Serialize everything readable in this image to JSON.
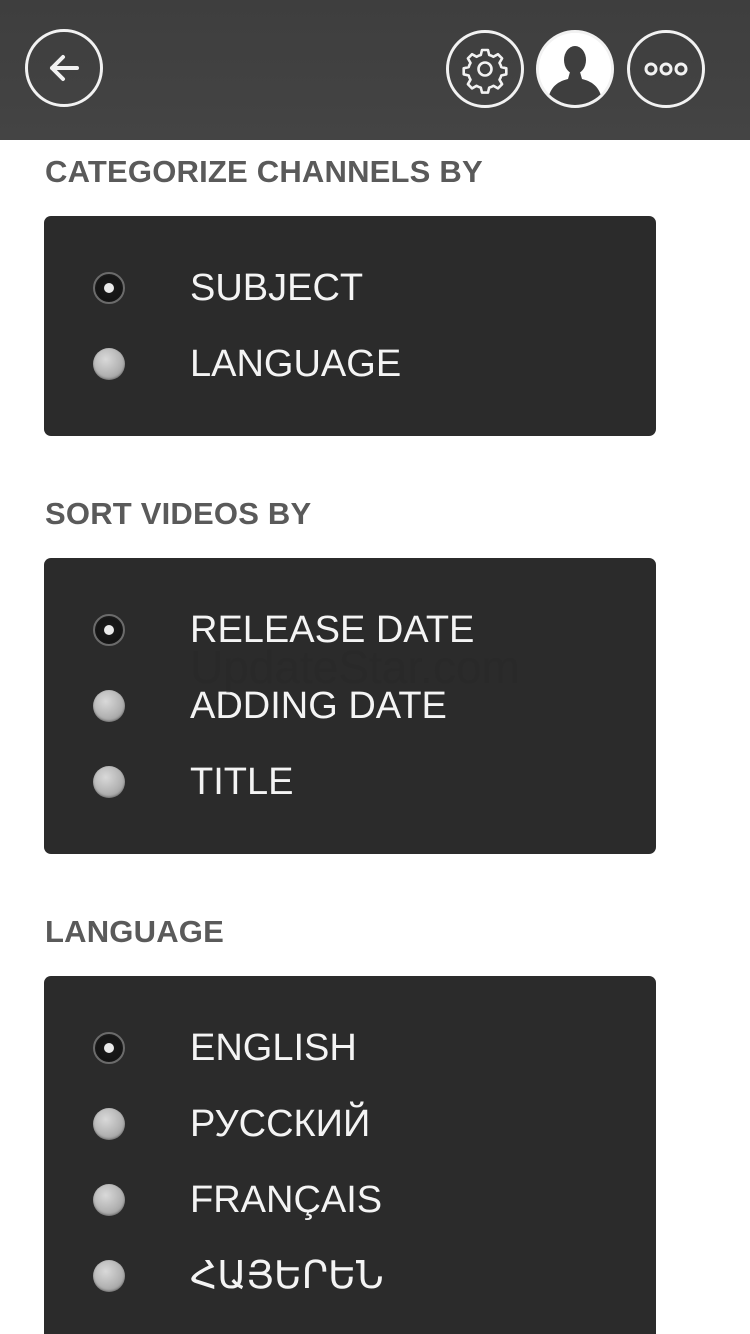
{
  "header": {
    "icons": [
      "back-arrow-icon",
      "gear-icon",
      "user-silhouette-icon",
      "more-dots-icon"
    ],
    "colors": {
      "bar": "#424242",
      "icon_stroke": "#f2f2f2"
    }
  },
  "sections": {
    "categorize": {
      "title": "CATEGORIZE CHANNELS BY",
      "options": [
        {
          "label": "SUBJECT",
          "selected": true
        },
        {
          "label": "LANGUAGE",
          "selected": false
        }
      ]
    },
    "sort": {
      "title": "SORT VIDEOS BY",
      "options": [
        {
          "label": "RELEASE DATE",
          "selected": true
        },
        {
          "label": "ADDING DATE",
          "selected": false
        },
        {
          "label": "TITLE",
          "selected": false
        }
      ]
    },
    "language": {
      "title": "LANGUAGE",
      "options": [
        {
          "label": "ENGLISH",
          "selected": true
        },
        {
          "label": "РУССКИЙ",
          "selected": false
        },
        {
          "label": "FRANÇAIS",
          "selected": false
        },
        {
          "label": "ՀԱՅԵՐԵՆ",
          "selected": false
        }
      ]
    }
  },
  "watermark": "UpdateStar.com",
  "colors": {
    "panel": "#2b2b2b",
    "section_title": "#5a5a5a",
    "option_text": "#f4f4f4"
  }
}
